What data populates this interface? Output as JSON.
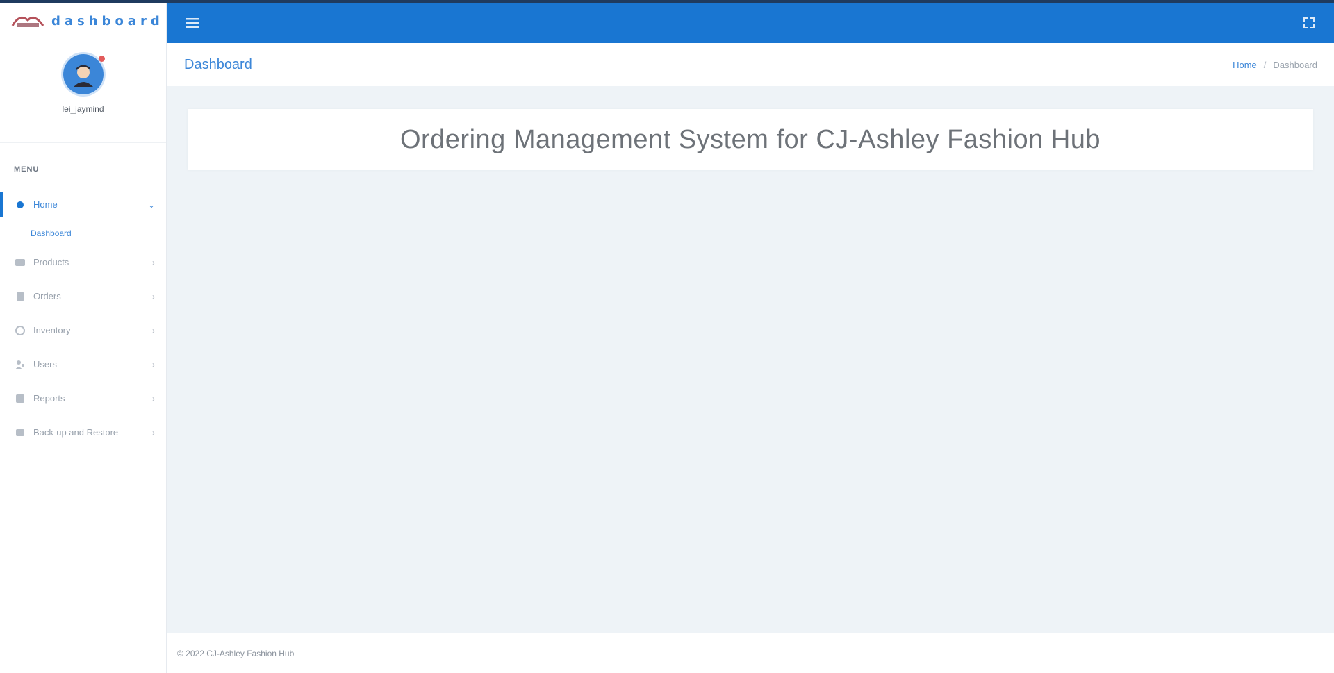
{
  "app": {
    "brand_text": "dashboard",
    "accent_color": "#1976d2"
  },
  "profile": {
    "name": "lei_jaymind"
  },
  "sidebar": {
    "menu_title": "MENU",
    "items": [
      {
        "label": "Home",
        "icon": "dot-icon",
        "active": true,
        "subitems": [
          {
            "label": "Dashboard"
          }
        ]
      },
      {
        "label": "Products",
        "icon": "products-icon",
        "active": false
      },
      {
        "label": "Orders",
        "icon": "orders-icon",
        "active": false
      },
      {
        "label": "Inventory",
        "icon": "inventory-icon",
        "active": false
      },
      {
        "label": "Users",
        "icon": "users-icon",
        "active": false
      },
      {
        "label": "Reports",
        "icon": "reports-icon",
        "active": false
      },
      {
        "label": "Back-up and Restore",
        "icon": "backup-icon",
        "active": false
      }
    ]
  },
  "topbar": {
    "menu_icon": "hamburger-icon",
    "right_icon": "expand-icon"
  },
  "page": {
    "title": "Dashboard",
    "breadcrumb": {
      "home": "Home",
      "separator": "/",
      "current": "Dashboard"
    }
  },
  "main": {
    "heading": "Ordering Management System for CJ-Ashley Fashion Hub"
  },
  "footer": {
    "text": "© 2022 CJ-Ashley Fashion Hub"
  }
}
